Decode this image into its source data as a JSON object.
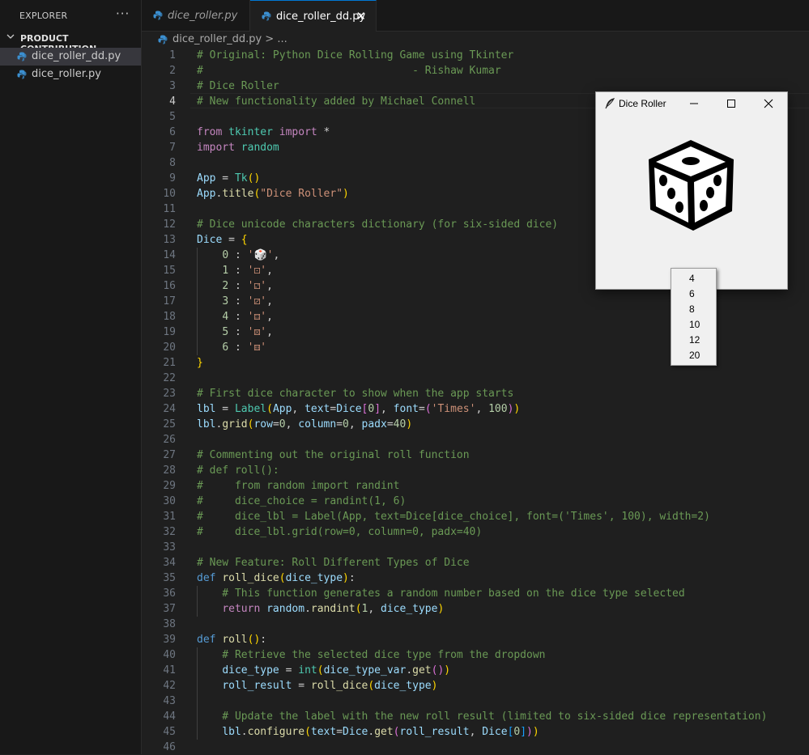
{
  "sidebar": {
    "title": "EXPLORER",
    "more": "···",
    "section": "PRODUCT CONTRIBUTION",
    "files": [
      {
        "name": "dice_roller_dd.py"
      },
      {
        "name": "dice_roller.py"
      }
    ]
  },
  "tabs": [
    {
      "label": "dice_roller.py"
    },
    {
      "label": "dice_roller_dd.py",
      "close": "✕"
    }
  ],
  "breadcrumb": {
    "file": "dice_roller_dd.py",
    "rest": " > ..."
  },
  "editor": {
    "current_line": 4,
    "lines": [
      {
        "n": "1",
        "t": "# Original: Python Dice Rolling Game using Tkinter"
      },
      {
        "n": "2",
        "t": "#                                 - Rishaw Kumar"
      },
      {
        "n": "3",
        "t": "# Dice Roller"
      },
      {
        "n": "4",
        "t": "# New functionality added by Michael Connell"
      },
      {
        "n": "5",
        "t": ""
      },
      {
        "n": "6",
        "t": "from tkinter import *"
      },
      {
        "n": "7",
        "t": "import random"
      },
      {
        "n": "8",
        "t": ""
      },
      {
        "n": "9",
        "t": "App = Tk()"
      },
      {
        "n": "10",
        "t": "App.title(\"Dice Roller\")"
      },
      {
        "n": "11",
        "t": ""
      },
      {
        "n": "12",
        "t": "# Dice unicode characters dictionary (for six-sided dice)"
      },
      {
        "n": "13",
        "t": "Dice = {"
      },
      {
        "n": "14",
        "t": "    0 : '🎲',"
      },
      {
        "n": "15",
        "t": "    1 : '⚀',"
      },
      {
        "n": "16",
        "t": "    2 : '⚁',"
      },
      {
        "n": "17",
        "t": "    3 : '⚂',"
      },
      {
        "n": "18",
        "t": "    4 : '⚃',"
      },
      {
        "n": "19",
        "t": "    5 : '⚄',"
      },
      {
        "n": "20",
        "t": "    6 : '⚅'"
      },
      {
        "n": "21",
        "t": "}"
      },
      {
        "n": "22",
        "t": ""
      },
      {
        "n": "23",
        "t": "# First dice character to show when the app starts"
      },
      {
        "n": "24",
        "t": "lbl = Label(App, text=Dice[0], font=('Times', 100))"
      },
      {
        "n": "25",
        "t": "lbl.grid(row=0, column=0, padx=40)"
      },
      {
        "n": "26",
        "t": ""
      },
      {
        "n": "27",
        "t": "# Commenting out the original roll function"
      },
      {
        "n": "28",
        "t": "# def roll():"
      },
      {
        "n": "29",
        "t": "#     from random import randint"
      },
      {
        "n": "30",
        "t": "#     dice_choice = randint(1, 6)"
      },
      {
        "n": "31",
        "t": "#     dice_lbl = Label(App, text=Dice[dice_choice], font=('Times', 100), width=2)"
      },
      {
        "n": "32",
        "t": "#     dice_lbl.grid(row=0, column=0, padx=40)"
      },
      {
        "n": "33",
        "t": ""
      },
      {
        "n": "34",
        "t": "# New Feature: Roll Different Types of Dice"
      },
      {
        "n": "35",
        "t": "def roll_dice(dice_type):"
      },
      {
        "n": "36",
        "t": "    # This function generates a random number based on the dice type selected"
      },
      {
        "n": "37",
        "t": "    return random.randint(1, dice_type)"
      },
      {
        "n": "38",
        "t": ""
      },
      {
        "n": "39",
        "t": "def roll():"
      },
      {
        "n": "40",
        "t": "    # Retrieve the selected dice type from the dropdown"
      },
      {
        "n": "41",
        "t": "    dice_type = int(dice_type_var.get())"
      },
      {
        "n": "42",
        "t": "    roll_result = roll_dice(dice_type)"
      },
      {
        "n": "43",
        "t": ""
      },
      {
        "n": "44",
        "t": "    # Update the label with the new roll result (limited to six-sided dice representation)"
      },
      {
        "n": "45",
        "t": "    lbl.configure(text=Dice.get(roll_result, Dice[0]))"
      },
      {
        "n": "46",
        "t": ""
      }
    ]
  },
  "tk_window": {
    "title": "Dice Roller",
    "selected": "6",
    "options": [
      "4",
      "6",
      "8",
      "10",
      "12",
      "20"
    ]
  },
  "colors": {
    "accent": "#0078d4",
    "python_icon": "#3b8fd0",
    "comment": "#6a9955",
    "keyword": "#c586c0",
    "string": "#ce9178"
  },
  "icons": {
    "python_file": "python-file-icon",
    "feather": "tk-feather-icon"
  }
}
